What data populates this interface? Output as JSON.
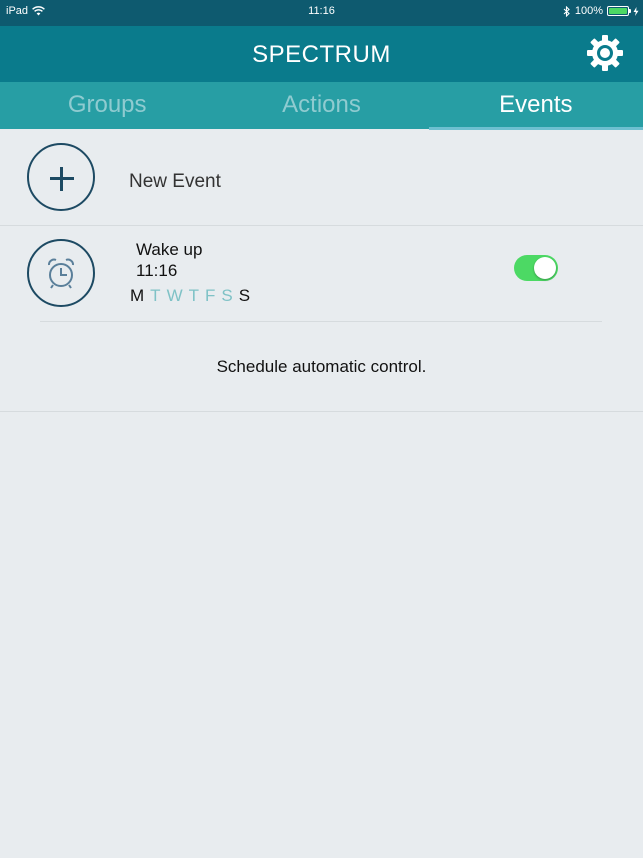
{
  "status": {
    "device": "iPad",
    "time": "11:16",
    "battery": "100%",
    "battery_level": 1.0
  },
  "nav": {
    "title": "SPECTRUM",
    "settings_icon": "gear-icon"
  },
  "tabs": [
    {
      "label": "Groups",
      "active": false
    },
    {
      "label": "Actions",
      "active": false
    },
    {
      "label": "Events",
      "active": true
    }
  ],
  "new_event": {
    "label": "New Event",
    "icon": "plus-icon"
  },
  "events": [
    {
      "name": "Wake up",
      "time": "11:16",
      "icon": "alarm-clock-icon",
      "enabled": true,
      "days": [
        {
          "letter": "M",
          "on": true
        },
        {
          "letter": "T",
          "on": false
        },
        {
          "letter": "W",
          "on": false
        },
        {
          "letter": "T",
          "on": false
        },
        {
          "letter": "F",
          "on": false
        },
        {
          "letter": "S",
          "on": false
        },
        {
          "letter": "S",
          "on": true
        }
      ]
    }
  ],
  "footer": {
    "text": "Schedule automatic control."
  },
  "colors": {
    "status_bar": "#0e5a6f",
    "nav_bar": "#0a7b8c",
    "tab_bar": "#279ea4",
    "toggle_on": "#4cd964",
    "day_off": "#7fc2c6",
    "background": "#e8ecef"
  }
}
